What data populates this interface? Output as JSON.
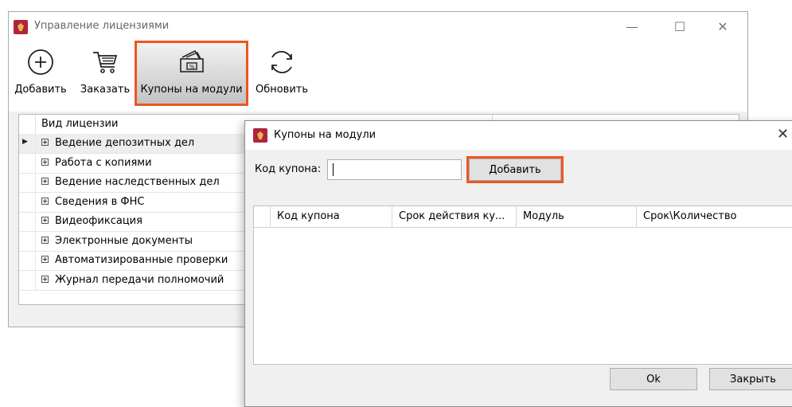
{
  "main_window": {
    "title": "Управление лицензиями",
    "controls": {
      "minimize": "—",
      "maximize": "☐",
      "close": "✕"
    }
  },
  "toolbar": {
    "buttons": [
      {
        "label": "Добавить",
        "icon": "plus-circle-icon"
      },
      {
        "label": "Заказать",
        "icon": "cart-icon"
      },
      {
        "label": "Купоны на модули",
        "icon": "coupons-icon",
        "active": true
      },
      {
        "label": "Обновить",
        "icon": "refresh-icon"
      }
    ]
  },
  "license_grid": {
    "column_header": "Вид лицензии",
    "rows": [
      {
        "label": "Ведение депозитных дел",
        "selected": true
      },
      {
        "label": "Работа с копиями"
      },
      {
        "label": "Ведение наследственных дел"
      },
      {
        "label": "Сведения в ФНС"
      },
      {
        "label": "Видеофиксация"
      },
      {
        "label": "Электронные документы"
      },
      {
        "label": "Автоматизированные проверки"
      },
      {
        "label": "Журнал передачи полномочий"
      }
    ]
  },
  "dialog": {
    "title": "Купоны на модули",
    "close": "✕",
    "coupon_code_label": "Код купона:",
    "coupon_code_value": "",
    "add_button": "Добавить",
    "table_columns": [
      "Код купона",
      "Срок действия ку...",
      "Модуль",
      "Срок\\Количество"
    ],
    "ok_button": "Ok",
    "close_button": "Закрыть"
  },
  "colors": {
    "highlight": "#ee5521",
    "app_icon": "#b1243d"
  }
}
